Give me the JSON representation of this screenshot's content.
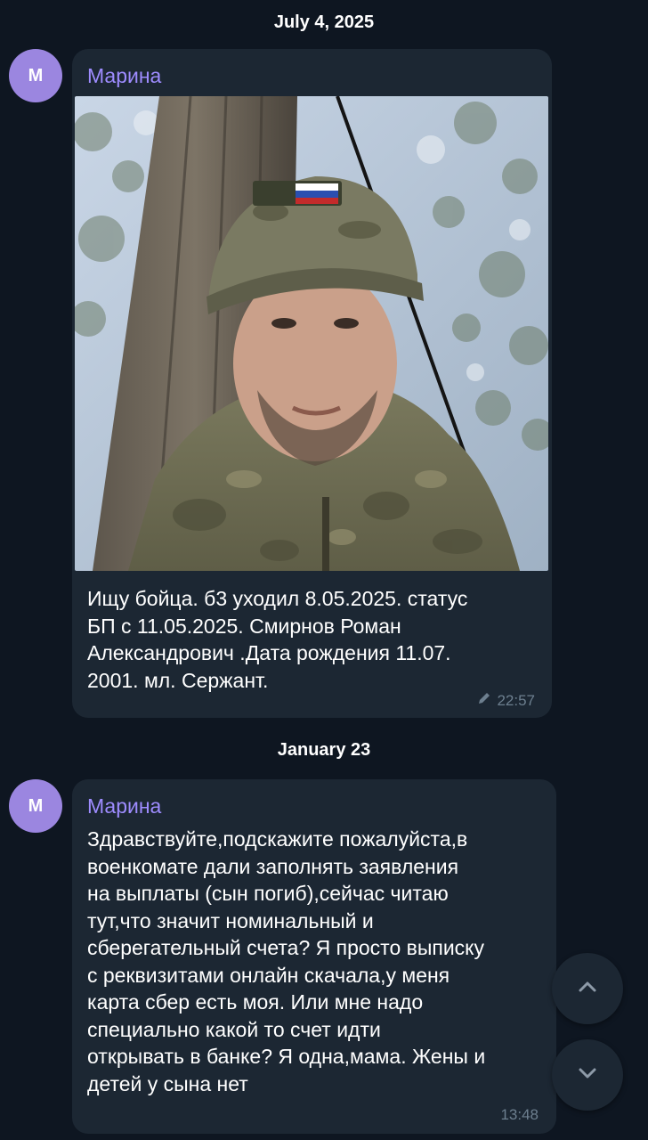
{
  "date_separator_1": "July 4, 2025",
  "date_separator_2": "January 23",
  "messages": [
    {
      "avatar_letter": "M",
      "sender": "Марина",
      "text": "Ищу бойца. б3 уходил 8.05.2025. статус\nБП с 11.05.2025. Смирнов Роман\nАлександрович .Дата рождения 11.07.\n2001. мл. Сержант.",
      "time": "22:57",
      "edited_icon": "pencil-icon",
      "has_photo": true
    },
    {
      "avatar_letter": "M",
      "sender": "Марина",
      "text": "Здравствуйте,подскажите пожалуйста,в\nвоенкомате дали заполнять заявления\nна выплаты (сын погиб),сейчас читаю\nтут,что значит номинальный и\nсберегательный счета? Я просто выписку\nс реквизитами онлайн скачала,у меня\nкарта сбер есть моя. Или мне надо\nспециально какой то счет идти\nоткрывать в банке? Я одна,мама. Жены и\nдетей у сына нет",
      "time": "13:48"
    }
  ],
  "buttons": {
    "scroll_up_icon": "chevron-up-icon",
    "scroll_down_icon": "chevron-down-icon"
  },
  "colors": {
    "background": "#0e1621",
    "bubble": "#1c2733",
    "sender_name": "#9e8cff",
    "avatar": "#9b86e0",
    "meta": "#6d7f8f"
  }
}
